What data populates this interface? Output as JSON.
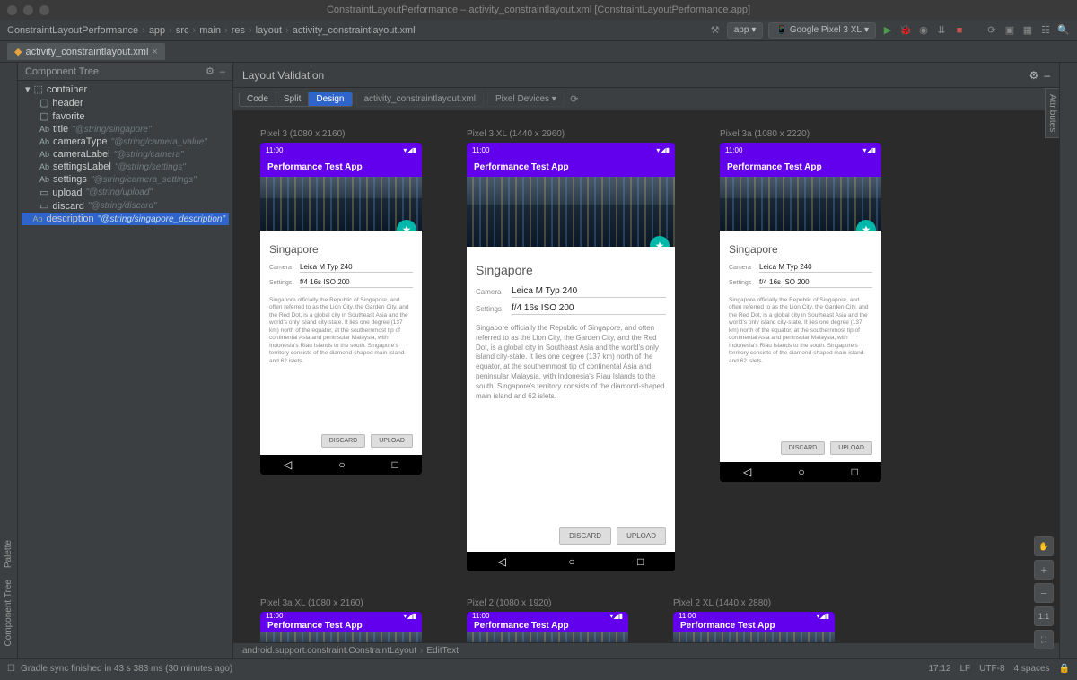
{
  "window": {
    "title": "ConstraintLayoutPerformance – activity_constraintlayout.xml [ConstraintLayoutPerformance.app]"
  },
  "breadcrumbs": [
    "ConstraintLayoutPerformance",
    "app",
    "src",
    "main",
    "res",
    "layout",
    "activity_constraintlayout.xml"
  ],
  "toolbar": {
    "config": "app",
    "device": "Google Pixel 3 XL"
  },
  "editorTab": "activity_constraintlayout.xml",
  "panel_title": "Layout Validation",
  "view_modes": {
    "code": "Code",
    "split": "Split",
    "design": "Design"
  },
  "chips": {
    "file": "activity_constraintlayout.xml",
    "devices": "Pixel Devices"
  },
  "componentTree": {
    "title": "Component Tree",
    "root": "container",
    "items": [
      {
        "icon": "box",
        "name": "header"
      },
      {
        "icon": "box",
        "name": "favorite"
      },
      {
        "icon": "Ab",
        "name": "title",
        "hint": "\"@string/singapore\""
      },
      {
        "icon": "Ab",
        "name": "cameraType",
        "hint": "\"@string/camera_value\""
      },
      {
        "icon": "Ab",
        "name": "cameraLabel",
        "hint": "\"@string/camera\""
      },
      {
        "icon": "Ab",
        "name": "settingsLabel",
        "hint": "\"@string/settings\""
      },
      {
        "icon": "Ab",
        "name": "settings",
        "hint": "\"@string/camera_settings\""
      },
      {
        "icon": "btn",
        "name": "upload",
        "hint": "\"@string/upload\""
      },
      {
        "icon": "btn",
        "name": "discard",
        "hint": "\"@string/discard\""
      },
      {
        "icon": "Ab",
        "name": "description",
        "hint": "\"@string/singapore_description\"",
        "selected": true
      }
    ]
  },
  "sideTabs": {
    "palette": "Palette",
    "componentTree": "Component Tree",
    "attributes": "Attributes"
  },
  "devices": [
    {
      "label": "Pixel 3 (1080 x 2160)",
      "cls": "p1"
    },
    {
      "label": "Pixel 3 XL (1440 x 2960)",
      "cls": "p2"
    },
    {
      "label": "Pixel 3a (1080 x 2220)",
      "cls": "p3"
    },
    {
      "label": "Pixel 3a XL (1080 x 2160)",
      "cls": "p4",
      "cut": true
    },
    {
      "label": "Pixel 2 (1080 x 1920)",
      "cls": "p5",
      "cut": true
    },
    {
      "label": "Pixel 2 XL (1440 x 2880)",
      "cls": "p6",
      "cut": true
    }
  ],
  "preview": {
    "time": "11:00",
    "appTitle": "Performance Test App",
    "title": "Singapore",
    "cameraLabel": "Camera",
    "cameraValue": "Leica M Typ 240",
    "settingsLabel": "Settings",
    "settingsValue": "f/4 16s ISO 200",
    "description": "Singapore officially the Republic of Singapore, and often referred to as the Lion City, the Garden City, and the Red Dot, is a global city in Southeast Asia and the world's only island city-state. It lies one degree (137 km) north of the equator, at the southernmost tip of continental Asia and peninsular Malaysia, with Indonesia's Riau Islands to the south. Singapore's territory consists of the diamond-shaped main island and 62 islets.",
    "discard": "DISCARD",
    "upload": "UPLOAD"
  },
  "bottomCrumb": [
    "android.support.constraint.ConstraintLayout",
    "EditText"
  ],
  "status": {
    "msg": "Gradle sync finished in 43 s 383 ms (30 minutes ago)",
    "time": "17:12",
    "lf": "LF",
    "enc": "UTF-8",
    "indent": "4 spaces"
  },
  "zoom": {
    "one": "1:1"
  }
}
